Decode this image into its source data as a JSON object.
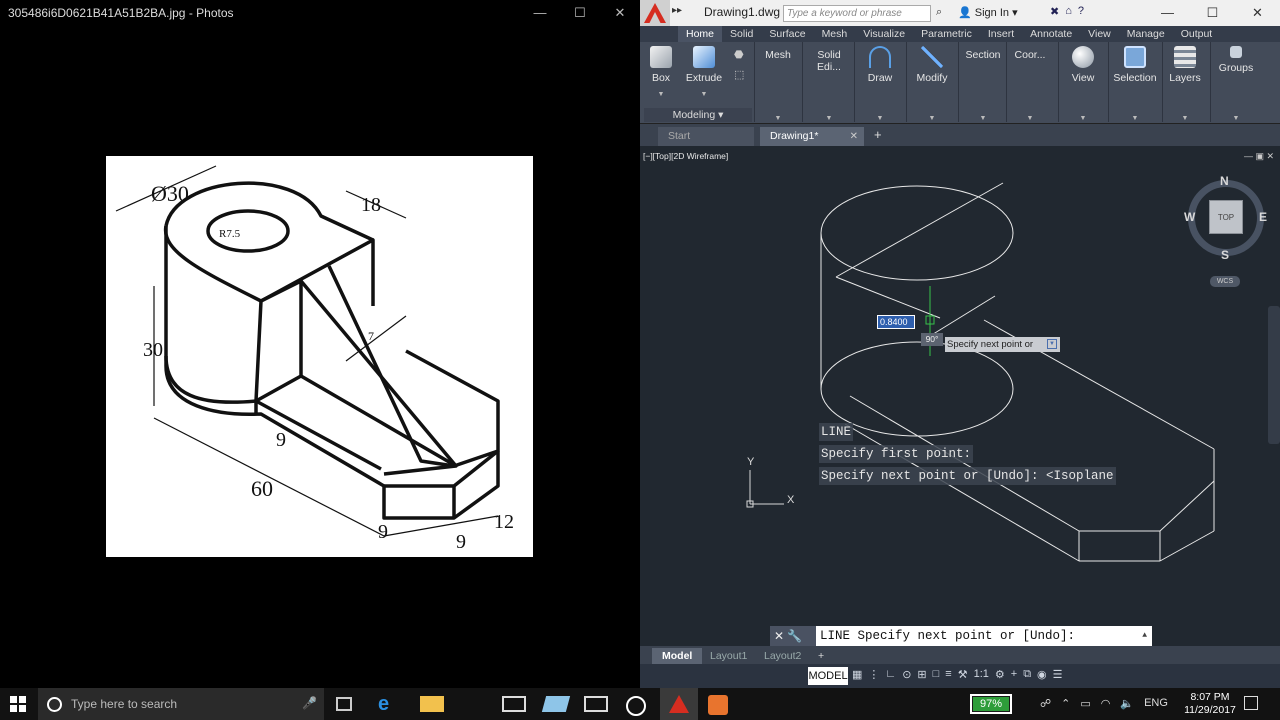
{
  "photos": {
    "title": "305486i6D0621B41A51B2BA.jpg - Photos",
    "controls": [
      "—",
      "☐",
      "✕"
    ],
    "drawing": {
      "dim_diameter": "Ø30",
      "dim_radius": "R7.5",
      "dim_18": "18",
      "dim_30": "30",
      "dim_7": "7",
      "dim_9a": "9",
      "dim_60": "60",
      "dim_9b": "9",
      "dim_9c": "9",
      "dim_12": "12"
    }
  },
  "autocad": {
    "doc_title": "Drawing1.dwg",
    "search_placeholder": "Type a keyword or phrase",
    "sign_in": "Sign In",
    "window_controls": [
      "—",
      "☐",
      "✕"
    ],
    "ribbon_tabs": [
      "Home",
      "Solid",
      "Surface",
      "Mesh",
      "Visualize",
      "Parametric",
      "Insert",
      "Annotate",
      "View",
      "Manage",
      "Output"
    ],
    "ribbon_buttons": {
      "box": "Box",
      "extrude": "Extrude",
      "mesh": "Mesh",
      "solid_editing": "Solid Edi...",
      "draw": "Draw",
      "modify": "Modify",
      "section": "Section",
      "coordinates": "Coor...",
      "view": "View",
      "selection": "Selection",
      "layers": "Layers",
      "groups": "Groups"
    },
    "panel_label": "Modeling",
    "file_tabs": {
      "start": "Start",
      "drawing": "Drawing1*",
      "close": "✕",
      "plus": "+"
    },
    "viewport_label": "[−][Top][2D Wireframe]",
    "viewcube": {
      "n": "N",
      "s": "S",
      "e": "E",
      "w": "W",
      "face": "TOP",
      "wcs": "WCS"
    },
    "dynamic_input": {
      "value": "0.8400",
      "angle": "90°",
      "prompt": "Specify next point or"
    },
    "ucs": {
      "x": "X",
      "y": "Y"
    },
    "command_history": [
      "LINE",
      "Specify first point:",
      "Specify next point or [Undo]:  <Isoplane"
    ],
    "command_line": "LINE Specify next point or [Undo]:",
    "layout_tabs": [
      "Model",
      "Layout1",
      "Layout2"
    ],
    "layout_plus": "+",
    "status": {
      "model": "MODEL",
      "scale": "1:1"
    }
  },
  "taskbar": {
    "search_placeholder": "Type here to search",
    "battery": "97%",
    "lang": "ENG",
    "time": "8:07 PM",
    "date": "11/29/2017"
  }
}
